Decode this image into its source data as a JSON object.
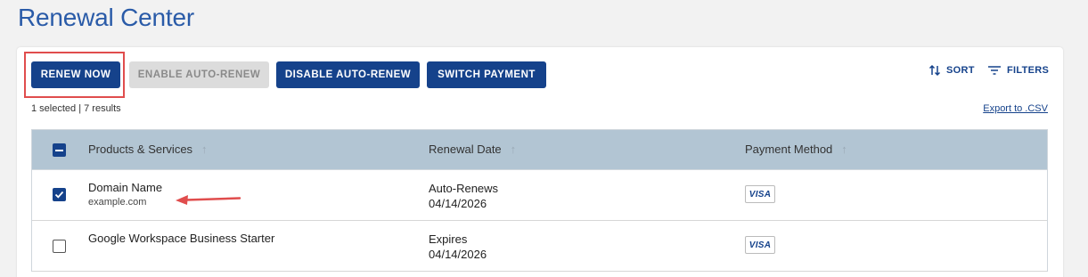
{
  "page": {
    "title": "Renewal Center"
  },
  "toolbar": {
    "renew_now": "RENEW NOW",
    "enable_auto_renew": "ENABLE AUTO-RENEW",
    "disable_auto_renew": "DISABLE AUTO-RENEW",
    "switch_payment": "SWITCH PAYMENT",
    "sort": "SORT",
    "filters": "FILTERS"
  },
  "meta": {
    "selection": "1 selected | 7 results",
    "export": "Export to .CSV"
  },
  "table": {
    "headers": [
      "Products & Services",
      "Renewal Date",
      "Payment Method"
    ],
    "rows": [
      {
        "checked": true,
        "product": "Domain Name",
        "detail": "example.com",
        "status": "Auto-Renews",
        "date": "04/14/2026",
        "payment": "VISA"
      },
      {
        "checked": false,
        "product": "Google Workspace Business Starter",
        "detail": "",
        "status": "Expires",
        "date": "04/14/2026",
        "payment": "VISA"
      }
    ]
  },
  "colors": {
    "primary": "#15428b",
    "title": "#2a5ba8",
    "header_bg": "#b2c5d3",
    "highlight": "#e04d4d"
  },
  "icons": [
    "sort-icon",
    "filter-icon",
    "sort-arrow-up-icon",
    "checkbox-checked-icon",
    "checkbox-indeterminate-icon",
    "visa-card-icon",
    "annotation-arrow-icon"
  ]
}
